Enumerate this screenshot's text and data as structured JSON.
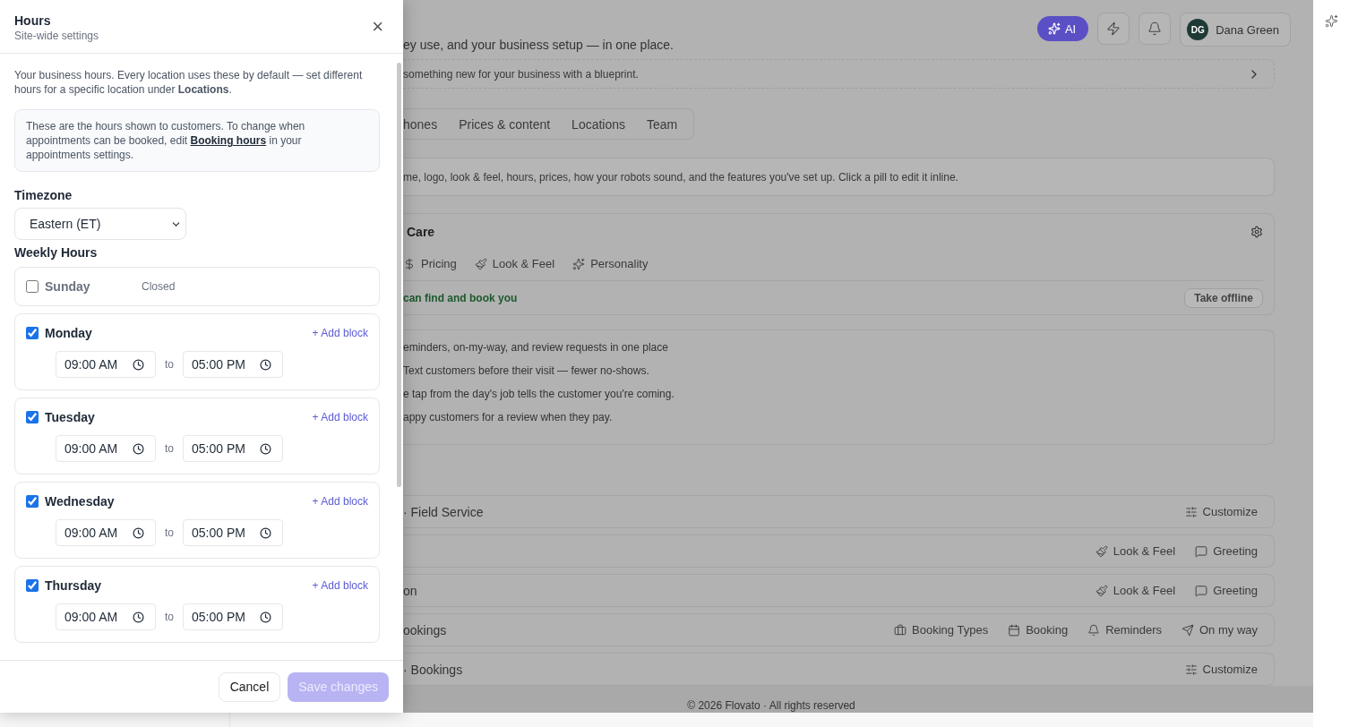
{
  "drawer": {
    "title": "Hours",
    "subtitle": "Site-wide settings",
    "close_label": "×",
    "intro": "Your business hours. Every location uses these by default — set different hours for a specific location under **Locations**.",
    "note": {
      "before": "These are the hours shown to customers. To change when appointments can be booked, edit",
      "link": "Booking hours",
      "after": "in your appointments settings."
    },
    "timezone": {
      "label": "Timezone",
      "value": "Eastern (ET)"
    },
    "weekly_label": "Weekly Hours",
    "days": [
      {
        "name": "Sunday",
        "open": false,
        "status": "Closed"
      },
      {
        "name": "Monday",
        "open": true,
        "add_label": "+ Add block",
        "blocks": [
          {
            "start": "09:00 AM",
            "separator": "to",
            "end": "05:00 PM"
          }
        ]
      },
      {
        "name": "Tuesday",
        "open": true,
        "add_label": "+ Add block",
        "blocks": [
          {
            "start": "09:00 AM",
            "separator": "to",
            "end": "05:00 PM"
          }
        ]
      },
      {
        "name": "Wednesday",
        "open": true,
        "add_label": "+ Add block",
        "blocks": [
          {
            "start": "09:00 AM",
            "separator": "to",
            "end": "05:00 PM"
          }
        ]
      },
      {
        "name": "Thursday",
        "open": true,
        "add_label": "+ Add block",
        "blocks": [
          {
            "start": "09:00 AM",
            "separator": "to",
            "end": "05:00 PM"
          }
        ]
      }
    ],
    "buttons": [
      {
        "label": "Cancel",
        "kind": "secondary",
        "disabled": false
      },
      {
        "label": "Save changes",
        "kind": "primary",
        "disabled": true
      }
    ]
  },
  "page": {
    "ai_label": "AI",
    "user": {
      "initials": "DG",
      "name": "Dana Green"
    },
    "subtitle": "ey use, and your business setup — in one place.",
    "blueprint": "something new for your business with a blueprint.",
    "tabs": [
      {
        "label": "hones",
        "selected": false
      },
      {
        "label": "Prices & content",
        "selected": false
      },
      {
        "label": "Locations",
        "selected": false
      },
      {
        "label": "Team",
        "selected": false
      }
    ],
    "info": "me, logo, look & feel, hours, prices, how your robots sound, and the features you've set up. Click a pill to edit it inline.",
    "card": {
      "title": "Care",
      "pills": [
        {
          "kind": "dollar",
          "label": "Pricing"
        },
        {
          "kind": "brush",
          "label": "Look & Feel"
        },
        {
          "kind": "sparkles",
          "label": "Personality"
        }
      ],
      "status": "can find and book you",
      "action": "Take offline"
    },
    "features": [
      "eminders, on-my-way, and review requests in one place",
      "Text customers before their visit — fewer no-shows.",
      "e tap from the day's job tells the customer you're coming.",
      "appy customers for a review when they pay."
    ],
    "rows": [
      {
        "title": "· Field Service",
        "actions": [
          {
            "kind": "sliders",
            "label": "Customize"
          }
        ]
      },
      {
        "actions": [
          {
            "kind": "brush",
            "label": "Look & Feel"
          },
          {
            "kind": "message",
            "label": "Greeting"
          }
        ]
      },
      {
        "title": "on",
        "actions": [
          {
            "kind": "brush",
            "label": "Look & Feel"
          },
          {
            "kind": "message",
            "label": "Greeting"
          }
        ]
      },
      {
        "title": "ookings",
        "actions": [
          {
            "kind": "briefcase",
            "label": "Booking Types"
          },
          {
            "kind": "calendar",
            "label": "Booking"
          },
          {
            "kind": "bell",
            "label": "Reminders"
          },
          {
            "kind": "send",
            "label": "On my way"
          }
        ]
      },
      {
        "title": "· Bookings",
        "actions": [
          {
            "kind": "sliders",
            "label": "Customize"
          }
        ]
      }
    ],
    "footer": "© 2026 Flovato · All rights reserved"
  }
}
